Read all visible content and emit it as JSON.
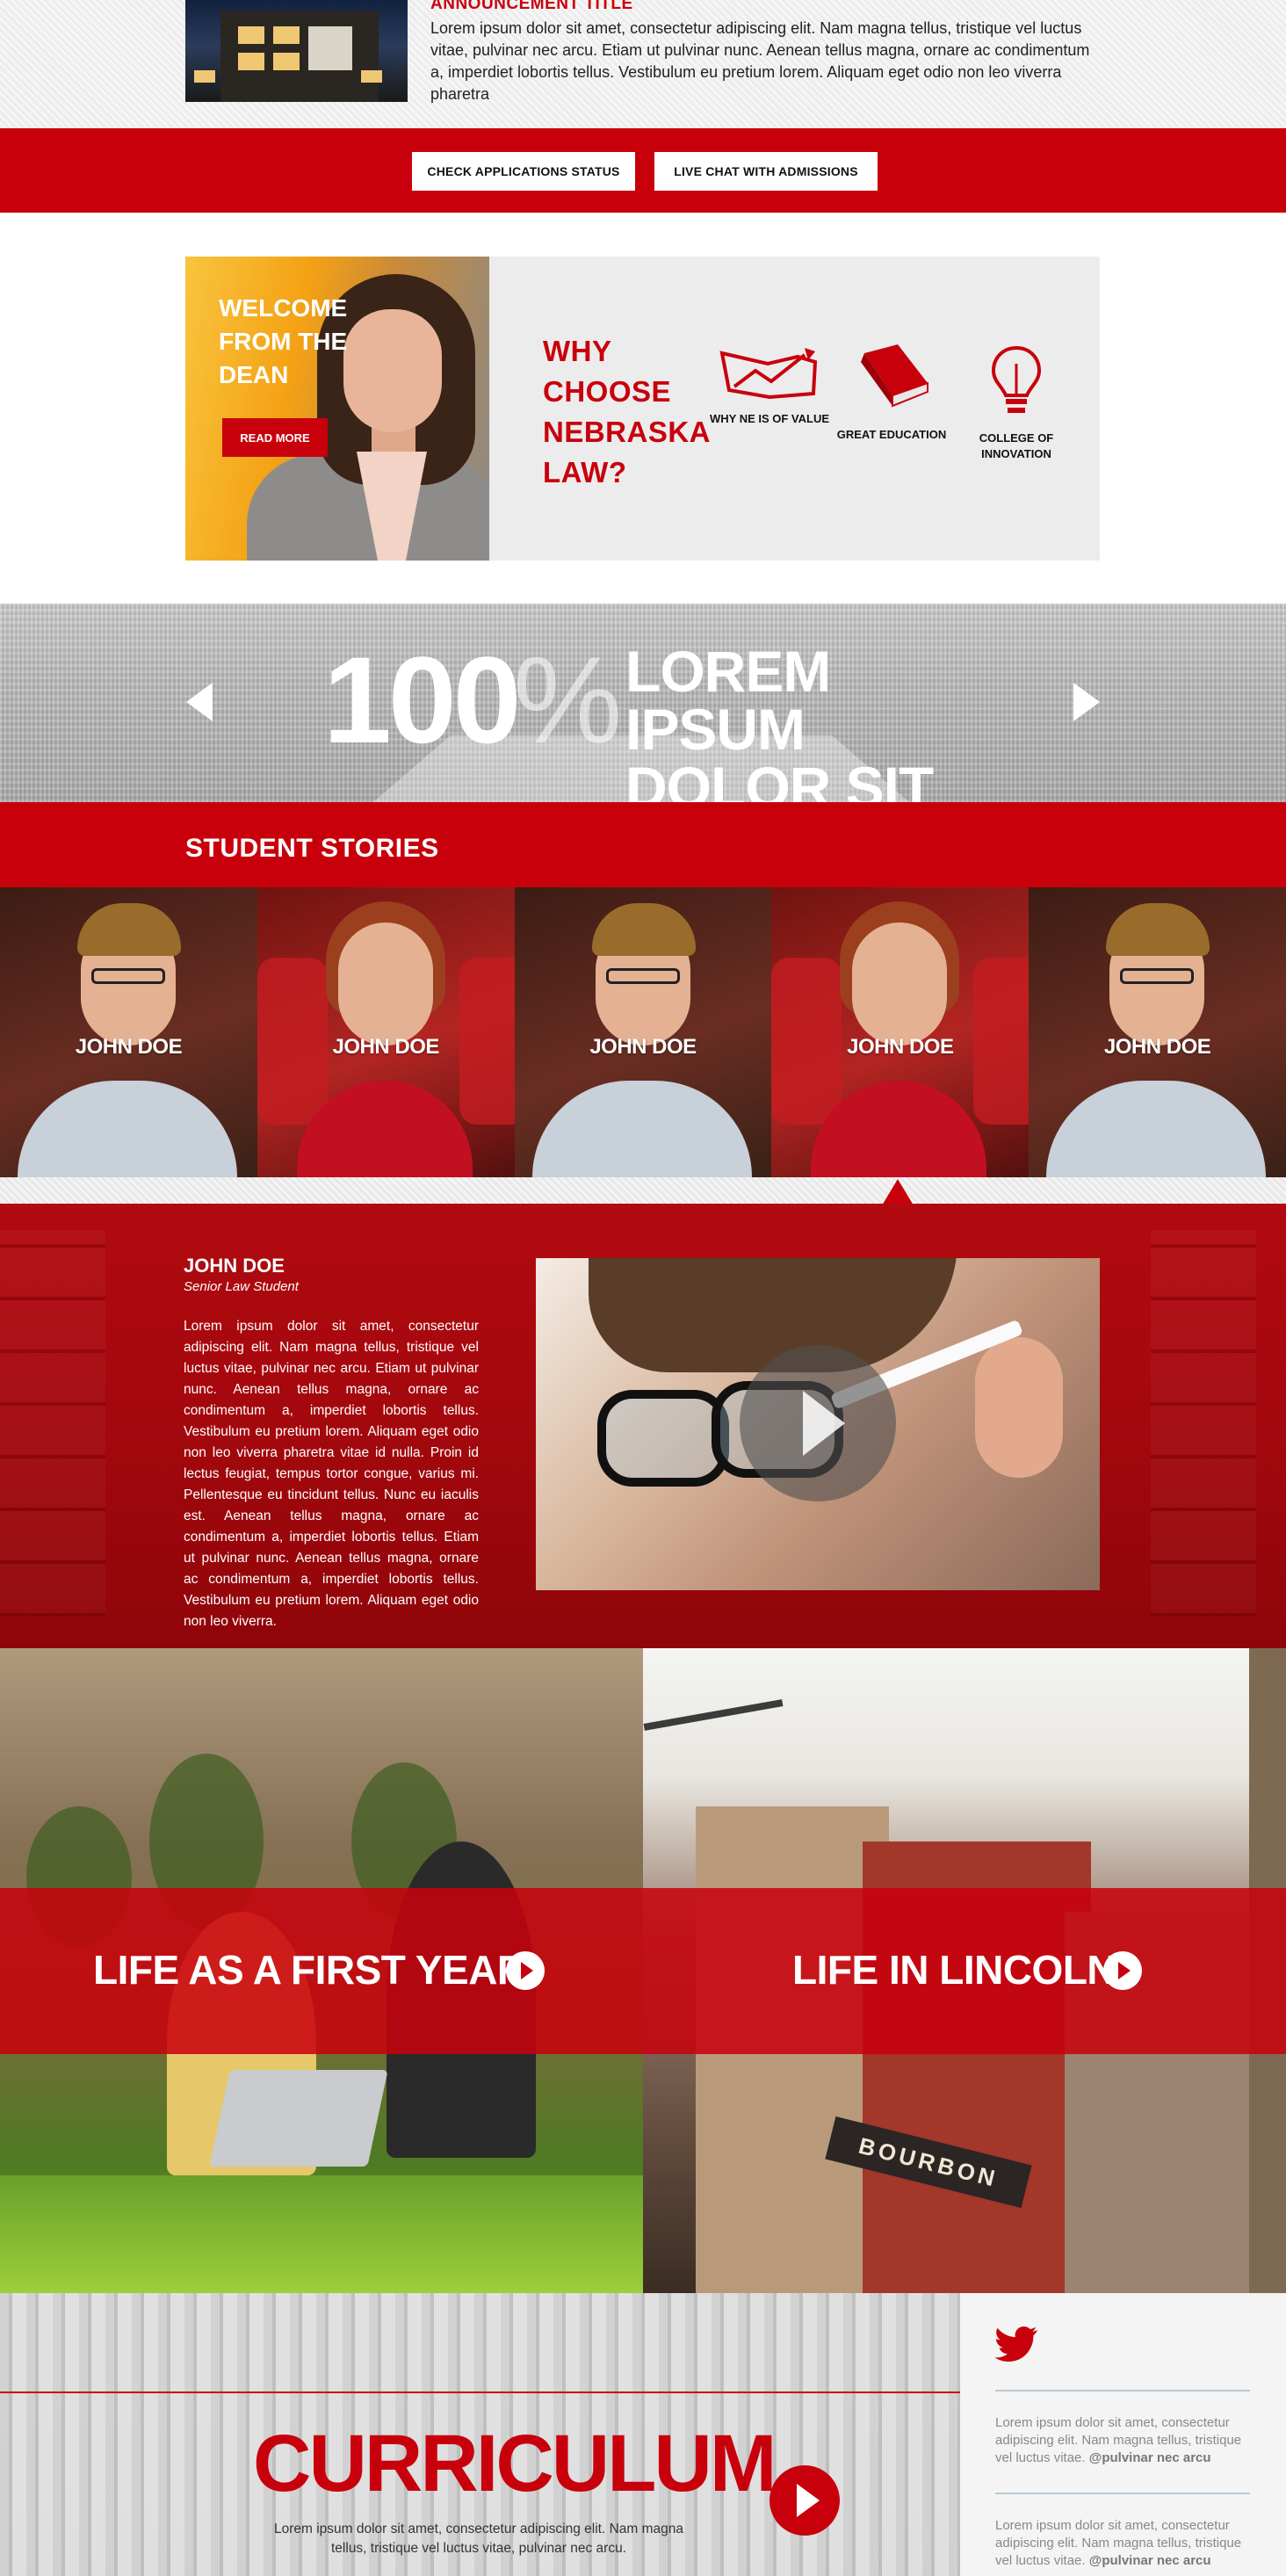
{
  "announcement": {
    "title": "ANNOUNCEMENT TITLE",
    "text": "Lorem ipsum dolor sit amet, consectetur adipiscing elit. Nam magna tellus, tristique vel luctus vitae, pulvinar nec arcu. Etiam ut pulvinar nunc. Aenean tellus magna, ornare ac condimentum a, imperdiet lobortis tellus. Vestibulum eu pretium lorem. Aliquam eget odio non leo viverra pharetra"
  },
  "buttons": {
    "status": "CHECK APPLICATIONS STATUS",
    "chat": "LIVE CHAT WITH ADMISSIONS"
  },
  "dean": {
    "welcome": "WELCOME FROM THE DEAN",
    "read_more": "READ MORE"
  },
  "why": {
    "title": "WHY CHOOSE NEBRASKA LAW?",
    "items": [
      {
        "label": "WHY NE IS OF VALUE",
        "icon": "chart-icon"
      },
      {
        "label": "GREAT EDUCATION",
        "icon": "book-icon"
      },
      {
        "label": "COLLEGE OF INNOVATION",
        "icon": "lightbulb-icon"
      }
    ]
  },
  "stat": {
    "number": "100",
    "unit": "%",
    "text": "LOREM IPSUM DOLOR SIT"
  },
  "stories": {
    "title": "STUDENT STORIES",
    "students": [
      {
        "name": "JOHN DOE"
      },
      {
        "name": "JOHN DOE"
      },
      {
        "name": "JOHN DOE"
      },
      {
        "name": "JOHN DOE"
      },
      {
        "name": "JOHN DOE"
      }
    ]
  },
  "featured": {
    "name": "JOHN DOE",
    "role": "Senior Law Student",
    "body": "Lorem ipsum dolor sit amet, consectetur adipiscing elit. Nam magna tellus, tristique vel luctus vitae, pulvinar nec arcu. Etiam ut pulvinar nunc. Aenean tellus magna, ornare ac condimentum a, imperdiet lobortis tellus. Vestibulum eu pretium lorem. Aliquam eget odio non leo viverra pharetra vitae id nulla. Proin id lectus feugiat, tempus tortor congue, varius mi. Pellentesque eu tincidunt tellus. Nunc eu iaculis est. Aenean tellus magna, ornare ac condimentum a, imperdiet lobortis tellus. Etiam ut pulvinar nunc. Aenean tellus magna, ornare ac condimentum a, imperdiet lobortis tellus. Vestibulum eu pretium lorem. Aliquam eget odio non leo viverra."
  },
  "life": {
    "first_year": "LIFE AS A FIRST YEAR",
    "lincoln": "LIFE IN LINCOLN",
    "sign": "BOURBON"
  },
  "curriculum": {
    "title": "CURRICULUM",
    "text": "Lorem ipsum dolor sit amet, consectetur adipiscing elit. Nam magna tellus, tristique vel luctus vitae, pulvinar nec arcu."
  },
  "twitter": {
    "tweets": [
      {
        "text": "Lorem ipsum dolor sit amet, consectetur adipiscing elit. Nam magna tellus, tristique vel luctus vitae.",
        "handle": "@pulvinar nec arcu"
      },
      {
        "text": "Lorem ipsum dolor sit amet, consectetur adipiscing elit. Nam magna tellus, tristique vel luctus vitae.",
        "handle": "@pulvinar nec arcu"
      }
    ]
  },
  "colors": {
    "brand_red": "#c8000c",
    "light_gray": "#ececec"
  }
}
